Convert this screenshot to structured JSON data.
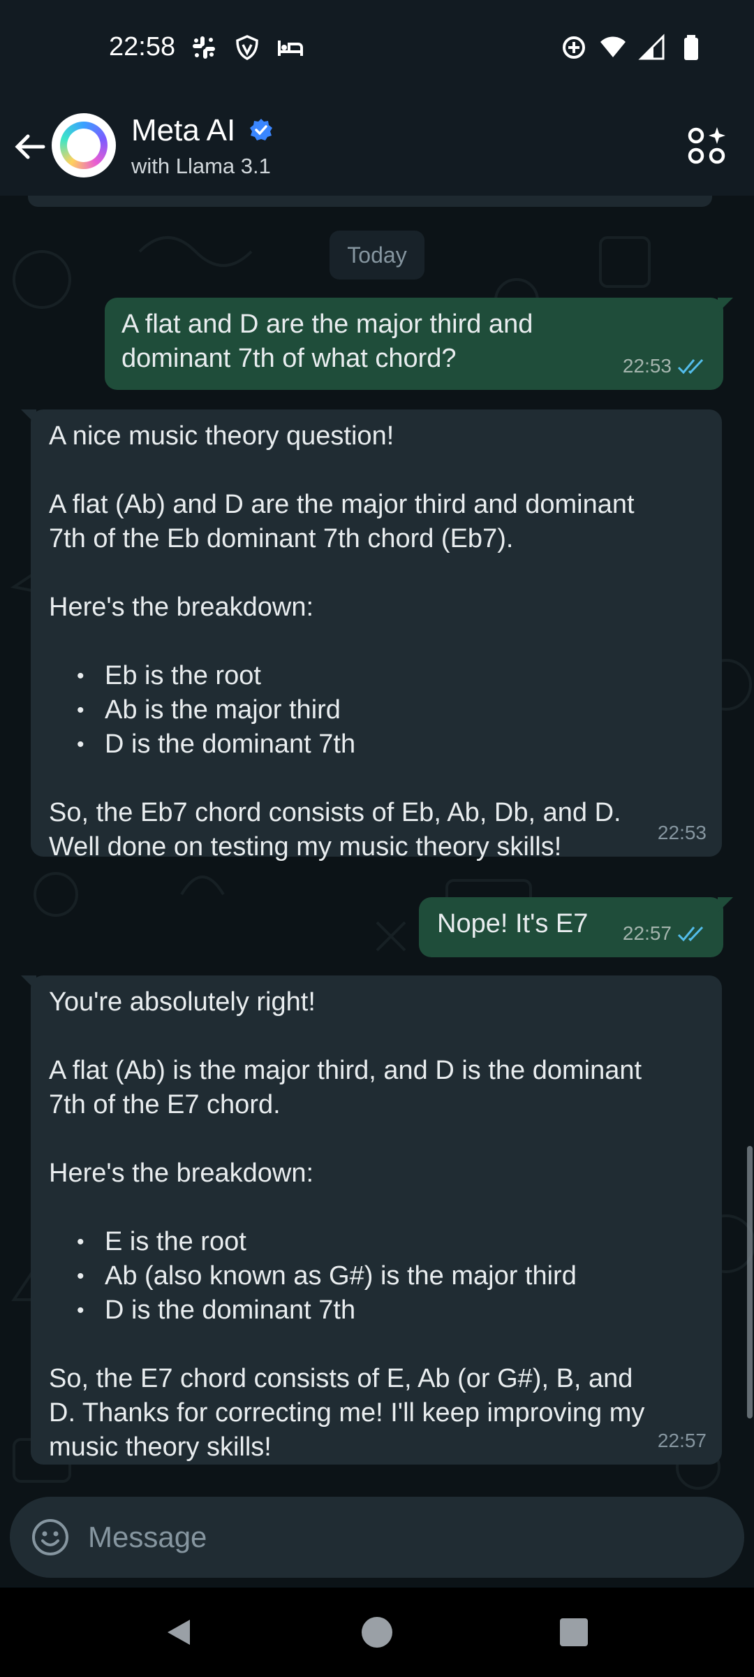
{
  "status_bar": {
    "time": "22:58",
    "left_icons": [
      "slack-icon",
      "vpn-shield-icon",
      "bed-icon"
    ],
    "right_icons": [
      "data-saver-icon",
      "wifi-icon",
      "signal-icon",
      "battery-icon"
    ]
  },
  "header": {
    "contact_name": "Meta AI",
    "subtitle": "with Llama 3.1",
    "verified": true
  },
  "chat": {
    "date_chip": "Today",
    "messages": [
      {
        "direction": "outgoing",
        "text": "A flat and D are the major third and\ndominant 7th of what chord?",
        "time": "22:53",
        "status": "read"
      },
      {
        "direction": "incoming",
        "intro": "A nice music theory question!",
        "para": "A flat (Ab) and D are the major third and dominant\n7th of the Eb dominant 7th chord (Eb7).",
        "lead": "Here's the breakdown:",
        "bullets": [
          "Eb is the root",
          "Ab is the major third",
          "D is the dominant 7th"
        ],
        "outro": "So, the Eb7 chord consists of Eb, Ab, Db, and D.\nWell done on testing my music theory skills!",
        "time": "22:53"
      },
      {
        "direction": "outgoing",
        "text": "Nope! It's E7",
        "time": "22:57",
        "status": "read"
      },
      {
        "direction": "incoming",
        "intro": "You're absolutely right!",
        "para": "A flat (Ab) is the major third, and D is the dominant\n7th of the E7 chord.",
        "lead": "Here's the breakdown:",
        "bullets": [
          "E is the root",
          "Ab (also known as G#) is the major third",
          "D is the dominant 7th"
        ],
        "outro": "So, the E7 chord consists of E, Ab (or G#), B, and\nD. Thanks for correcting me! I'll keep improving my\nmusic theory skills!",
        "time": "22:57"
      }
    ]
  },
  "composer": {
    "placeholder": "Message"
  },
  "colors": {
    "background": "#0b141a",
    "outgoing_bubble": "#1f4d3a",
    "incoming_bubble": "#202c33",
    "read_ticks": "#53bdeb",
    "verified_badge": "#3a86ff"
  }
}
